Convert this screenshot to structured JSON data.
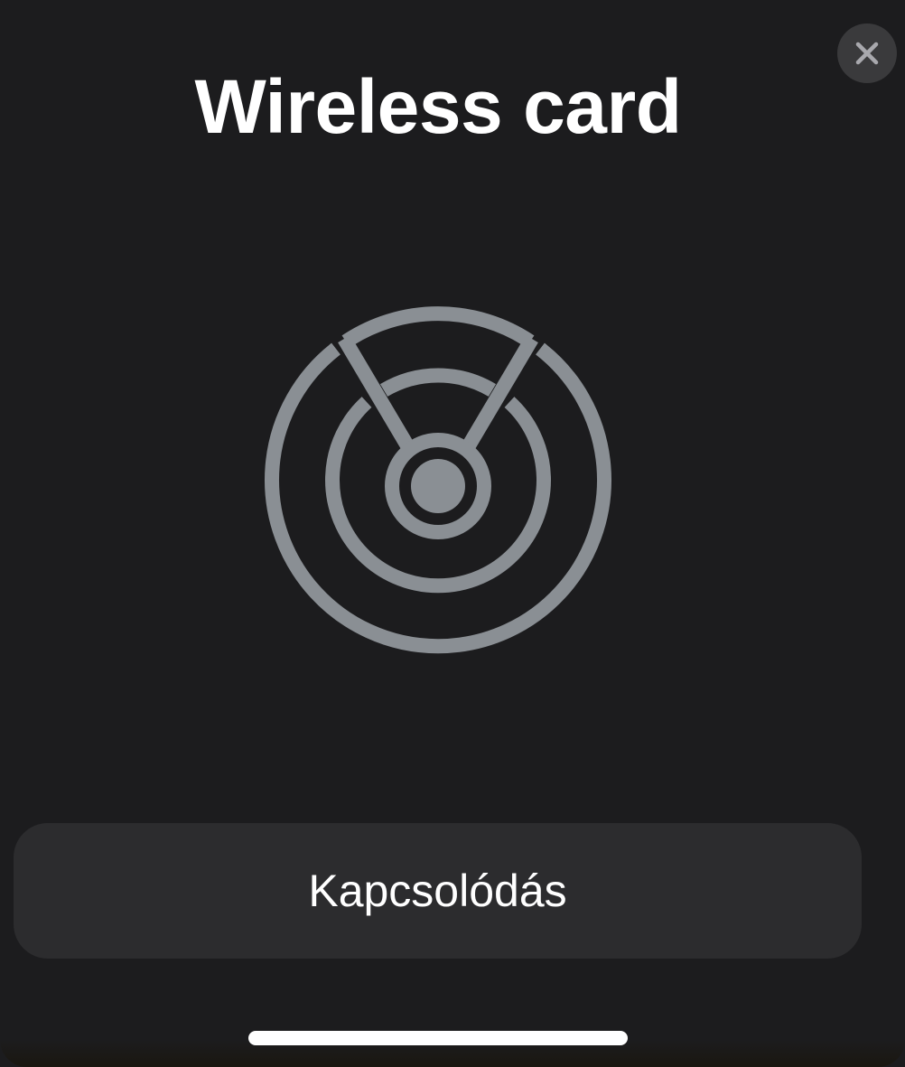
{
  "sheet": {
    "title": "Wireless card",
    "close_icon": "close-icon",
    "illustration_icon": "wireless-card-reader-icon",
    "illustration_color": "#8a8f94",
    "connect_button_label": "Kapcsolódás"
  },
  "colors": {
    "background": "#1c1c1e",
    "button_background": "#2c2c2e",
    "close_button_background": "#3a3a3c",
    "text": "#ffffff"
  }
}
